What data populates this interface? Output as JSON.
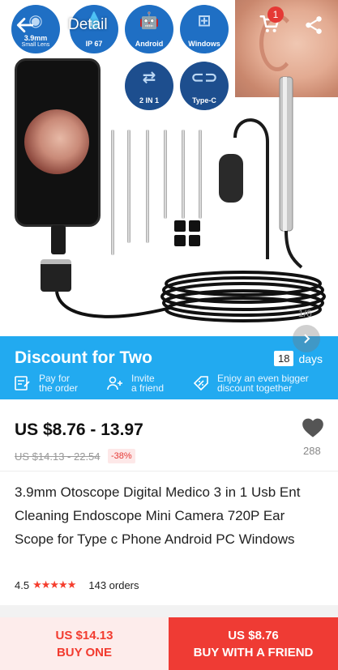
{
  "header": {
    "title": "Detail",
    "cart_count": "1"
  },
  "hero": {
    "spec_badges": [
      {
        "label": "3.9mm",
        "sub": "Small Lens",
        "glyph": "◉"
      },
      {
        "label": "IP 67",
        "sub": "",
        "glyph": "💧"
      },
      {
        "label": "Android",
        "sub": "",
        "glyph": "🤖"
      },
      {
        "label": "Windows",
        "sub": "",
        "glyph": "⊞"
      },
      {
        "label": "2 IN 1",
        "sub": "",
        "glyph": "⇄"
      },
      {
        "label": "Type-C",
        "sub": "",
        "glyph": "⊂⊃"
      }
    ],
    "image_counter": "1/6"
  },
  "discount": {
    "title": "Discount for Two",
    "days_value": "18",
    "days_label": "days",
    "steps": [
      {
        "line1": "Pay for",
        "line2": "the order",
        "icon": "pay-icon"
      },
      {
        "line1": "Invite",
        "line2": "a friend",
        "icon": "invite-icon"
      },
      {
        "line1": "Enjoy an even bigger",
        "line2": "discount together",
        "icon": "discount-icon"
      }
    ]
  },
  "product": {
    "price_range": "US $8.76 - 13.97",
    "original_price": "US $14.13 - 22.54",
    "discount_percent": "-38%",
    "wishlist_count": "288",
    "title": "3.9mm Otoscope Digital Medico 3 in 1 Usb Ent Cleaning Endoscope Mini Camera 720P Ear Scope for Type c Phone Android PC Windows",
    "rating": "4.5",
    "stars": "★★★★★",
    "orders": "143 orders"
  },
  "actions": {
    "buy_one_price": "US $14.13",
    "buy_one_label": "BUY ONE",
    "buy_friend_price": "US $8.76",
    "buy_friend_label": "BUY WITH A FRIEND"
  },
  "colors": {
    "discount_banner": "#22aaf0",
    "accent_red": "#ef3b34",
    "badge_blue": "#1f6fc4"
  }
}
